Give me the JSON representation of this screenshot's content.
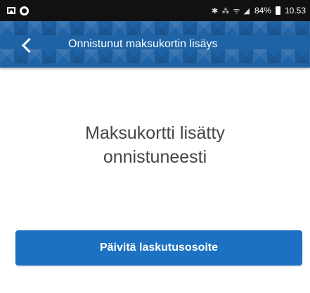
{
  "status_bar": {
    "indicators": "✱ ⁂ ᯤ ◢",
    "battery": "84%",
    "time": "10.53",
    "icons": [
      "gallery-icon",
      "app-notification-icon",
      "bluetooth-icon",
      "wifi-icon",
      "signal-icon",
      "battery-icon"
    ]
  },
  "app_bar": {
    "title": "Onnistunut maksukortin lisäys",
    "back_icon": "chevron-left-icon",
    "color": "#1e63a6"
  },
  "message": {
    "line1": "Maksukortti lisätty",
    "line2": "onnistuneesti"
  },
  "primary_button": {
    "label": "Päivitä laskutusosoite",
    "color": "#1c71c2"
  }
}
